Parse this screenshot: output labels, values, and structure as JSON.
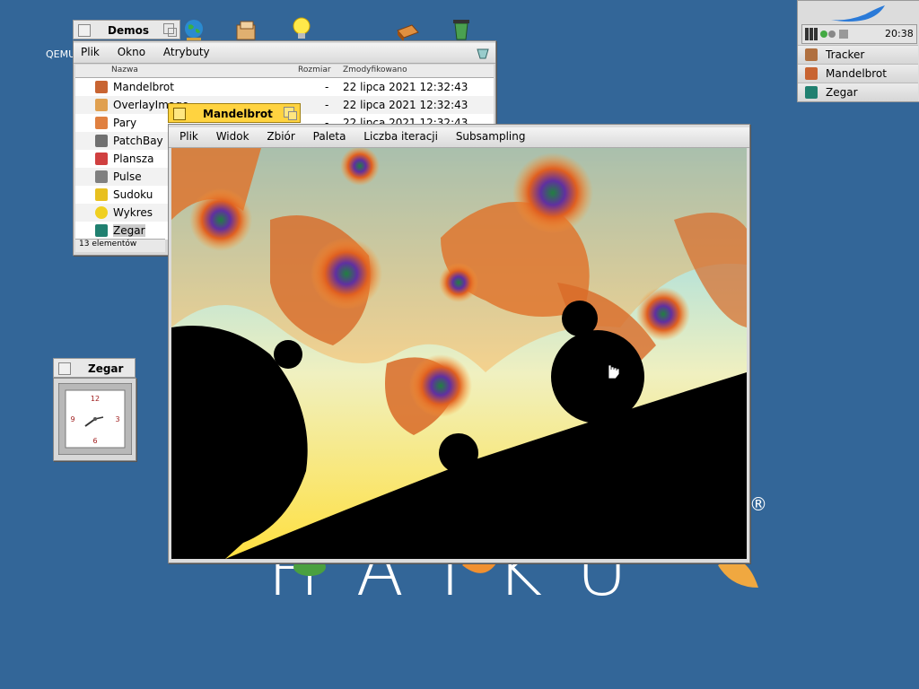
{
  "desktop": {
    "qemu_label": "QEMU",
    "logo_text": "HAIKU",
    "registered_mark": "®"
  },
  "demos_window": {
    "title": "Demos",
    "menu": [
      "Plik",
      "Okno",
      "Atrybuty"
    ],
    "columns": {
      "name": "Nazwa",
      "size": "Rozmiar",
      "modified": "Zmodyfikowano"
    },
    "rows": [
      {
        "name": "Mandelbrot",
        "size": "-",
        "modified": "22 lipca 2021 12:32:43",
        "icon": "mandelbrot-icon",
        "color": "#c86432"
      },
      {
        "name": "OverlayImage",
        "size": "-",
        "modified": "22 lipca 2021 12:32:43",
        "icon": "overlay-icon",
        "color": "#e0a050"
      },
      {
        "name": "Pary",
        "size": "-",
        "modified": "22 lipca 2021 12:32:43",
        "icon": "pary-icon",
        "color": "#e08040"
      },
      {
        "name": "PatchBay",
        "size": "",
        "modified": "",
        "icon": "patchbay-icon",
        "color": "#707070"
      },
      {
        "name": "Plansza",
        "size": "",
        "modified": "",
        "icon": "plansza-icon",
        "color": "#d04040"
      },
      {
        "name": "Pulse",
        "size": "",
        "modified": "",
        "icon": "pulse-icon",
        "color": "#808080"
      },
      {
        "name": "Sudoku",
        "size": "",
        "modified": "",
        "icon": "sudoku-icon",
        "color": "#e8c020"
      },
      {
        "name": "Wykres",
        "size": "",
        "modified": "",
        "icon": "wykres-icon",
        "color": "#f0d020"
      },
      {
        "name": "Zegar",
        "size": "",
        "modified": "",
        "icon": "zegar-icon",
        "color": "#208070"
      }
    ],
    "status": "13 elementów"
  },
  "mandelbrot_window": {
    "title": "Mandelbrot",
    "menu": [
      "Plik",
      "Widok",
      "Zbiór",
      "Paleta",
      "Liczba iteracji",
      "Subsampling"
    ]
  },
  "zegar_window": {
    "title": "Zegar",
    "numerals": [
      "12",
      "3",
      "6",
      "9"
    ]
  },
  "deskbar": {
    "time": "20:38",
    "items": [
      {
        "label": "Tracker",
        "icon": "tracker-icon",
        "color": "#b07040"
      },
      {
        "label": "Mandelbrot",
        "icon": "mandelbrot-icon",
        "color": "#c86432"
      },
      {
        "label": "Zegar",
        "icon": "zegar-icon",
        "color": "#208070"
      }
    ]
  }
}
